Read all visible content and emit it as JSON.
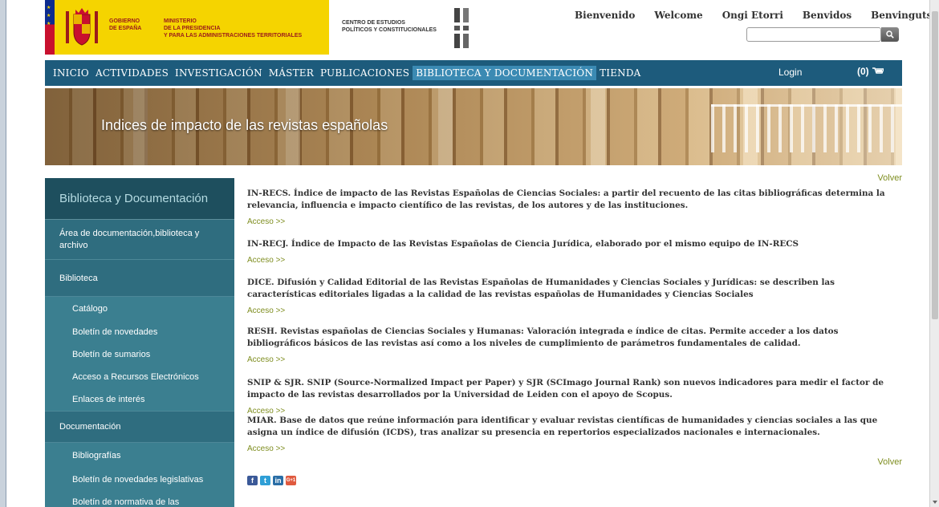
{
  "header": {
    "gov_line1": "GOBIERNO",
    "gov_line2": "DE ESPAÑA",
    "min_line1": "MINISTERIO",
    "min_line2": "DE LA PRESIDENCIA",
    "min_line3": "Y PARA LAS ADMINISTRACIONES TERRITORIALES",
    "cepc_line1": "CENTRO DE ESTUDIOS",
    "cepc_line2": "POLÍTICOS Y CONSTITUCIONALES",
    "languages": [
      "Bienvenido",
      "Welcome",
      "Ongi Etorri",
      "Benvidos",
      "Benvinguts"
    ],
    "search_value": ""
  },
  "nav": {
    "items": [
      "INICIO",
      "ACTIVIDADES",
      "INVESTIGACIÓN",
      "MÁSTER",
      "PUBLICACIONES",
      "BIBLIOTECA Y DOCUMENTACIÓN",
      "TIENDA"
    ],
    "active": "BIBLIOTECA Y DOCUMENTACIÓN",
    "login": "Login",
    "cart": "(0)"
  },
  "banner": {
    "title": "Indices de impacto de las revistas españolas"
  },
  "sidebar": {
    "title": "Biblioteca y Documentación",
    "items": [
      {
        "label": "Área de documentación,biblioteca y archivo",
        "type": "main"
      },
      {
        "label": "Biblioteca",
        "type": "main"
      },
      {
        "label": "Catálogo",
        "type": "sub"
      },
      {
        "label": "Boletín de novedades",
        "type": "sub"
      },
      {
        "label": "Boletín de sumarios",
        "type": "sub"
      },
      {
        "label": "Acceso a Recursos Electrónicos",
        "type": "sub"
      },
      {
        "label": "Enlaces de interés",
        "type": "sub"
      },
      {
        "label": "Documentación",
        "type": "main"
      },
      {
        "label": "Bibliografías",
        "type": "sub"
      },
      {
        "label": "Boletín de novedades legislativas",
        "type": "sub"
      },
      {
        "label": "Boletín de normativa de las",
        "type": "sub"
      }
    ]
  },
  "content": {
    "volver": "Volver",
    "entries": [
      {
        "text": "IN-RECS. Índice de impacto de las Revistas Españolas de Ciencias Sociales: a partir del recuento de las citas bibliográficas determina la relevancia, influencia e impacto científico de las revistas, de los autores y de las instituciones.",
        "link": "Acceso >>"
      },
      {
        "text": "IN-RECJ. Índice de Impacto de las Revistas Españolas de Ciencia Jurídica, elaborado por el mismo equipo de IN-RECS",
        "link": "Acceso >>"
      },
      {
        "text": "DICE. Difusión y Calidad Editorial de las Revistas Españolas de Humanidades y Ciencias Sociales y Jurídicas: se describen las características editoriales ligadas a la calidad de las revistas españolas de Humanidades y Ciencias Sociales",
        "link": "Acceso >>"
      },
      {
        "text": "RESH. Revistas españolas de Ciencias Sociales y Humanas: Valoración integrada e índice de citas. Permite acceder a los datos bibliográficos básicos de las revistas así como a los niveles de cumplimiento de parámetros fundamentales de calidad.",
        "link": "Acceso >>"
      },
      {
        "text": "SNIP & SJR. SNIP (Source-Normalized Impact per Paper) y SJR (SCImago Journal Rank) son nuevos indicadores para medir el factor de impacto de las revistas desarrollados por la Universidad de Leiden con el apoyo de Scopus.",
        "link": "Acceso >>"
      },
      {
        "text": "MIAR. Base de datos que reúne información para identificar y evaluar revistas científicas de humanidades y ciencias sociales a las que asigna un índice de difusión (ICDS), tras analizar su presencia en repertorios especializados nacionales e internacionales.",
        "link": "Acceso >>"
      }
    ],
    "social": [
      {
        "icon": "facebook-icon",
        "glyph": "f",
        "color": "#3b5998"
      },
      {
        "icon": "twitter-icon",
        "glyph": "t",
        "color": "#2f9fd6"
      },
      {
        "icon": "linkedin-icon",
        "glyph": "in",
        "color": "#2a6ea6"
      },
      {
        "icon": "google-plus-icon",
        "glyph": "G+1",
        "color": "#e05a3f"
      }
    ]
  }
}
